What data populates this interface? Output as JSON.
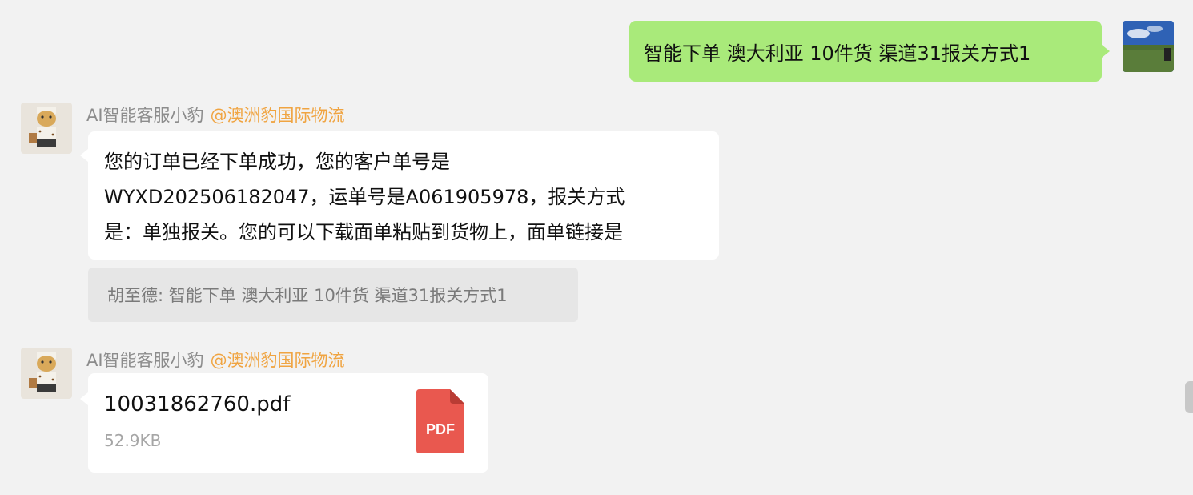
{
  "outgoing": {
    "text": "智能下单 澳大利亚 10件货 渠道31报关方式1"
  },
  "messages": [
    {
      "sender_name": "AI智能客服小豹",
      "sender_mention": "@澳洲豹国际物流",
      "lines": [
        "您的订单已经下单成功，您的客户单号是",
        "WYXD202506182047，运单号是A061905978，报关方式",
        "是：单独报关。您的可以下载面单粘贴到货物上，面单链接是"
      ],
      "quote": "胡至德: 智能下单 澳大利亚 10件货 渠道31报关方式1"
    },
    {
      "sender_name": "AI智能客服小豹",
      "sender_mention": "@澳洲豹国际物流",
      "file": {
        "name": "10031862760.pdf",
        "size": "52.9KB",
        "icon_label": "PDF"
      }
    }
  ],
  "colors": {
    "background": "#f2f2f2",
    "outgoing_bubble": "#a9ea7a",
    "mention": "#f0a441",
    "pdf_icon": "#e9584f"
  }
}
